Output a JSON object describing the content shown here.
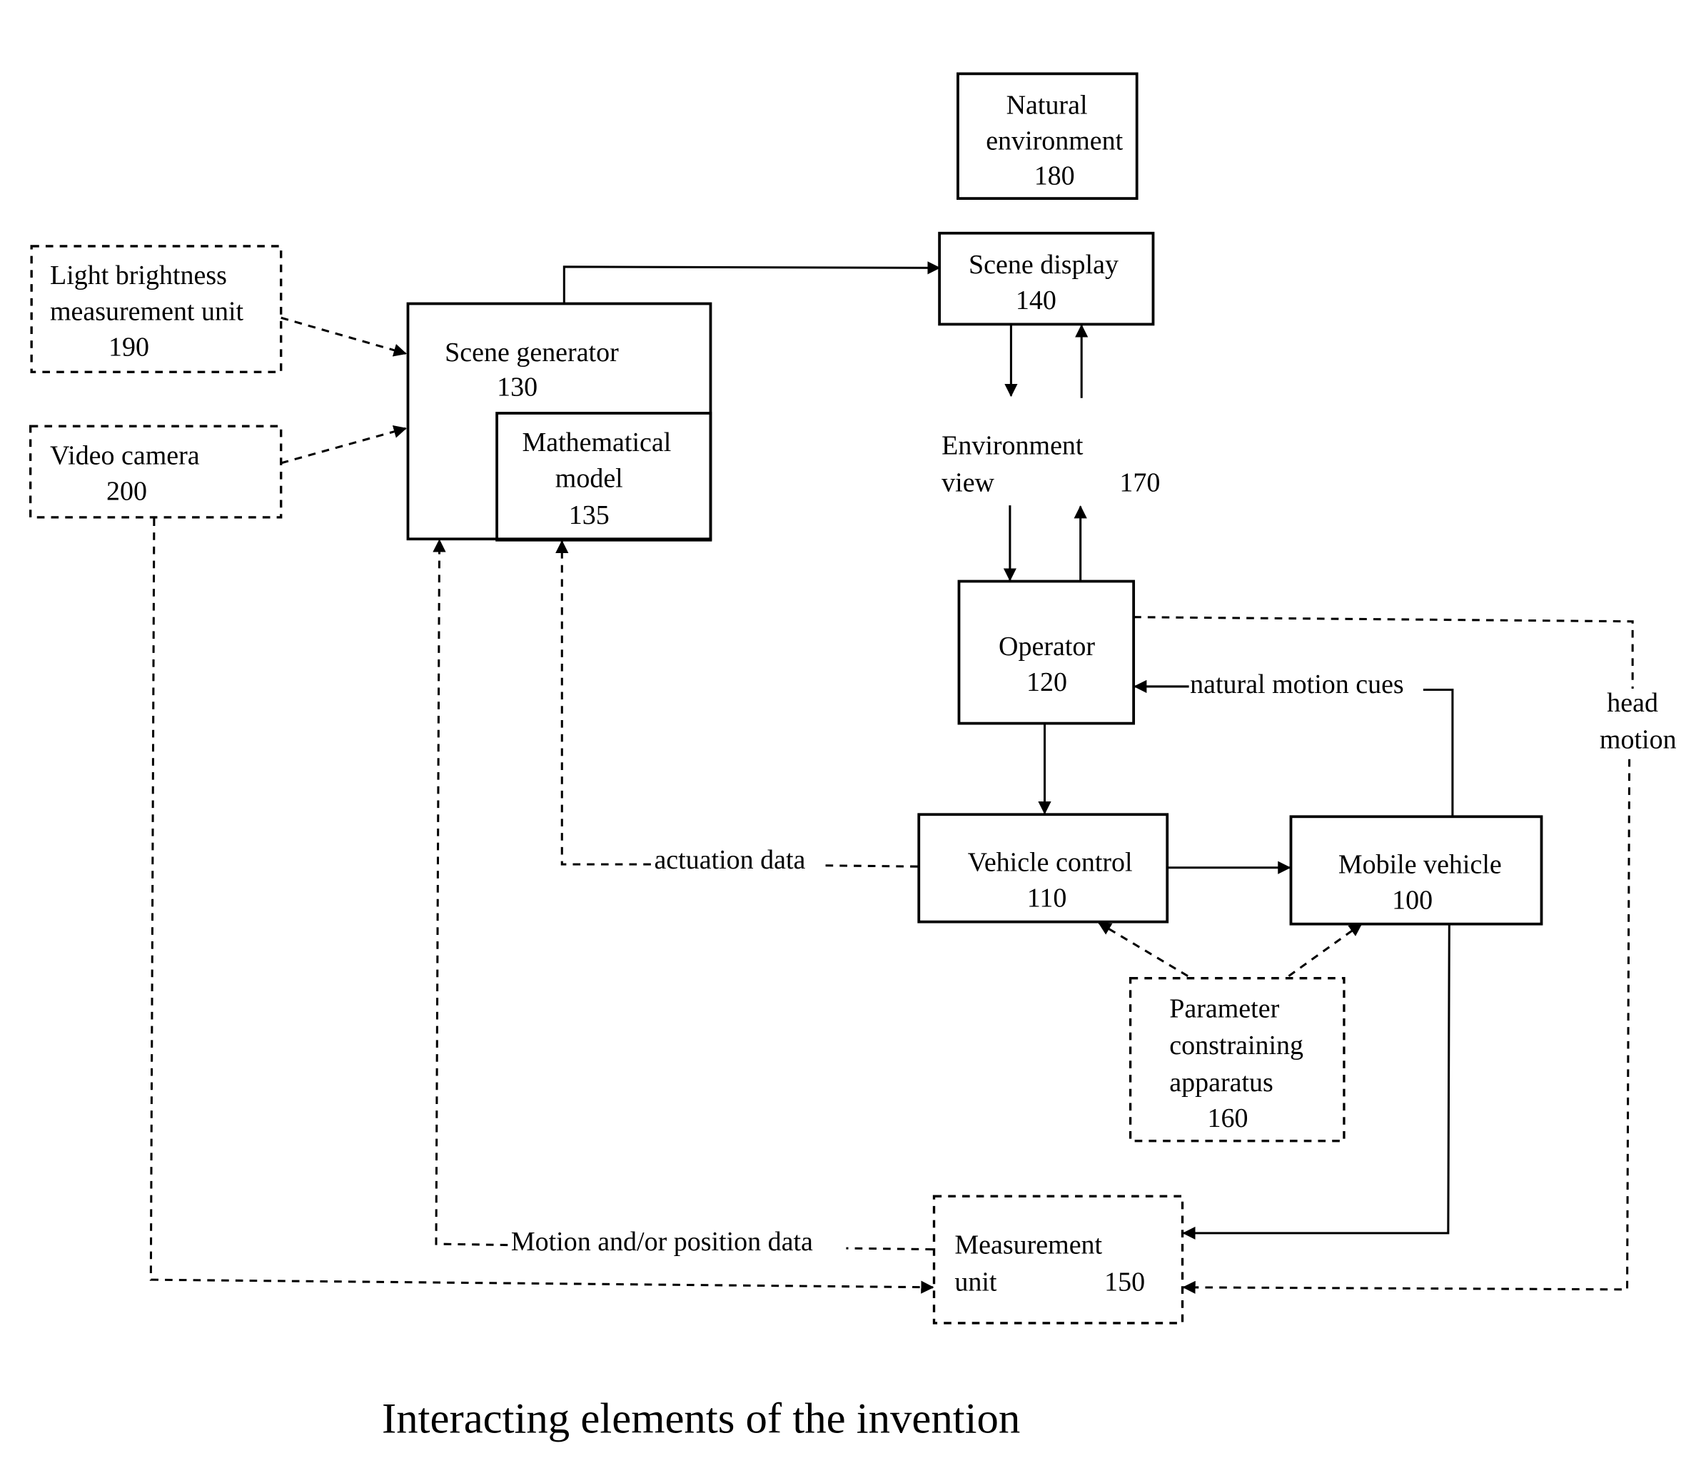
{
  "caption": "Interacting elements of the invention",
  "blocks": {
    "natural_environment": {
      "lines": [
        "Natural",
        "environment",
        "180"
      ]
    },
    "scene_display": {
      "lines": [
        "Scene display",
        "140"
      ]
    },
    "light_brightness": {
      "lines": [
        "Light brightness",
        "measurement unit",
        "190"
      ]
    },
    "video_camera": {
      "lines": [
        "Video camera",
        "200"
      ]
    },
    "scene_generator": {
      "lines": [
        "Scene generator",
        "130"
      ]
    },
    "math_model": {
      "lines": [
        "Mathematical",
        "model",
        "135"
      ]
    },
    "environment_view": {
      "lines": [
        "Environment",
        "view",
        "170"
      ]
    },
    "operator": {
      "lines": [
        "Operator",
        "120"
      ]
    },
    "vehicle_control": {
      "lines": [
        "Vehicle control",
        "110"
      ]
    },
    "mobile_vehicle": {
      "lines": [
        "Mobile vehicle",
        "100"
      ]
    },
    "parameter_apparatus": {
      "lines": [
        "Parameter",
        "constraining",
        "apparatus",
        "160"
      ]
    },
    "measurement_unit": {
      "lines": [
        "Measurement",
        "unit",
        "150"
      ]
    }
  },
  "edge_labels": {
    "natural_motion_cues": "natural motion cues",
    "head_motion": [
      "head",
      "motion"
    ],
    "actuation_data": "actuation data",
    "motion_position_data": "Motion and/or position data"
  }
}
